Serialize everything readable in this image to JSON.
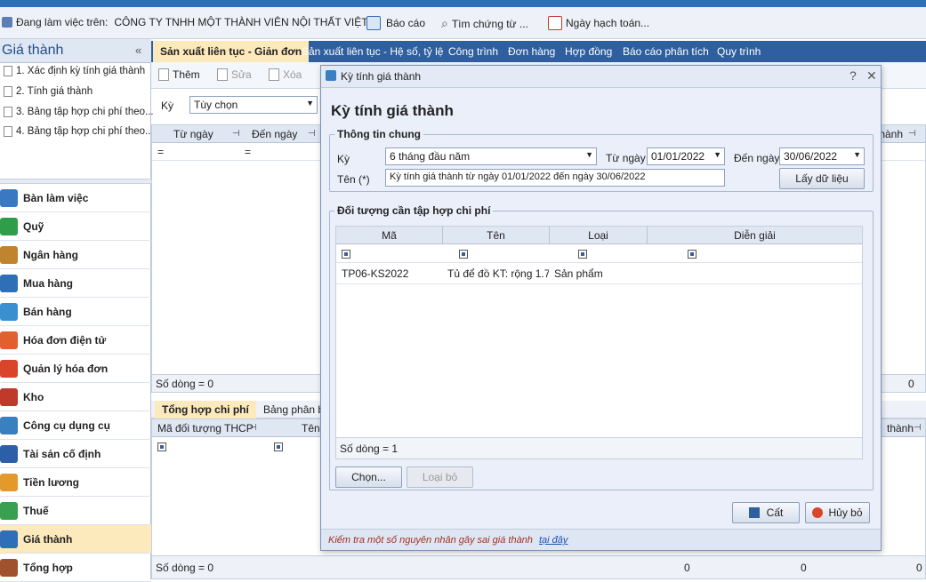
{
  "app": {
    "working_on_label": "Đang làm việc trên:",
    "company": "CÔNG TY TNHH MỘT THÀNH VIÊN NỘI THẤT VIỆT",
    "report_button": "Báo cáo",
    "find_voucher": "Tìm chứng từ ...",
    "posting_date": "Ngày hạch toán..."
  },
  "sidebar": {
    "title": "Giá thành",
    "collapse": "«",
    "links": [
      "1. Xác định kỳ tính giá thành",
      "2. Tính giá thành",
      "3. Bảng tập hợp chi phí theo...",
      "4. Bảng tập hợp chi phí theo..."
    ],
    "modules": [
      {
        "label": "Bàn làm việc",
        "color": "#3b78c4"
      },
      {
        "label": "Quỹ",
        "color": "#2e9e4a"
      },
      {
        "label": "Ngân hàng",
        "color": "#c0842e"
      },
      {
        "label": "Mua hàng",
        "color": "#2f6fb7"
      },
      {
        "label": "Bán hàng",
        "color": "#3a8fd0"
      },
      {
        "label": "Hóa đơn điện tử",
        "color": "#e06030"
      },
      {
        "label": "Quản lý hóa đơn",
        "color": "#d9452b"
      },
      {
        "label": "Kho",
        "color": "#c0392b"
      },
      {
        "label": "Công cụ dụng cụ",
        "color": "#3a7fc0"
      },
      {
        "label": "Tài sản cố định",
        "color": "#2d5fa8"
      },
      {
        "label": "Tiền lương",
        "color": "#e39a2b"
      },
      {
        "label": "Thuế",
        "color": "#3aa050"
      },
      {
        "label": "Giá thành",
        "color": "#2f6fb7",
        "active": true
      },
      {
        "label": "Tổng hợp",
        "color": "#a0522d"
      }
    ]
  },
  "tabs": [
    "Sản xuất liên tục - Giản đơn",
    "Sản xuất liên tục - Hệ số, tỷ lệ",
    "Công trình",
    "Đơn hàng",
    "Hợp đồng",
    "Báo cáo phân tích",
    "Quy trình"
  ],
  "toolbar": {
    "add": "Thêm",
    "edit": "Sửa",
    "delete": "Xóa"
  },
  "filter": {
    "label": "Kỳ",
    "value": "Tùy chọn"
  },
  "upper_grid": {
    "col_from": "Từ ngày",
    "col_to": "Đến ngày",
    "col_right": "thành",
    "row_count": "Số dòng = 0",
    "right_zero": "0",
    "eq": "="
  },
  "lower_tabs": [
    "Tổng hợp chi phí",
    "Bảng phân b"
  ],
  "lower_grid": {
    "col_code": "Mã đối tượng THCP",
    "col_name": "Tên",
    "col_right": "thành",
    "row_count": "Số dòng = 0",
    "totals": [
      "0",
      "0",
      "0"
    ]
  },
  "dialog": {
    "window_title": "Kỳ tính giá thành",
    "help": "?",
    "close": "✕",
    "heading": "Kỳ tính giá thành",
    "general_group": "Thông tin chung",
    "period_label": "Kỳ",
    "period_value": "6 tháng đầu năm",
    "from_label": "Từ ngày",
    "from_value": "01/01/2022",
    "to_label": "Đến ngày",
    "to_value": "30/06/2022",
    "name_label": "Tên (*)",
    "name_value": "Kỳ tính giá thành từ ngày 01/01/2022 đến ngày 30/06/2022",
    "fetch_button": "Lấy dữ liệu",
    "objects_group": "Đối tượng cần tập hợp chi phí",
    "columns": [
      "Mã",
      "Tên",
      "Loại",
      "Diễn giải"
    ],
    "rows": [
      {
        "code": "TP06-KS2022",
        "name": "Tủ để đồ KT: rộng 1.7",
        "type": "Sản phẩm",
        "desc": ""
      }
    ],
    "row_count": "Số dòng = 1",
    "choose_button": "Chọn...",
    "remove_button": "Loại bỏ",
    "save_button": "Cất",
    "cancel_button": "Hủy bỏ",
    "footer_text": "Kiểm tra một số nguyên nhân gây sai giá thành",
    "footer_link": "tại đây"
  }
}
